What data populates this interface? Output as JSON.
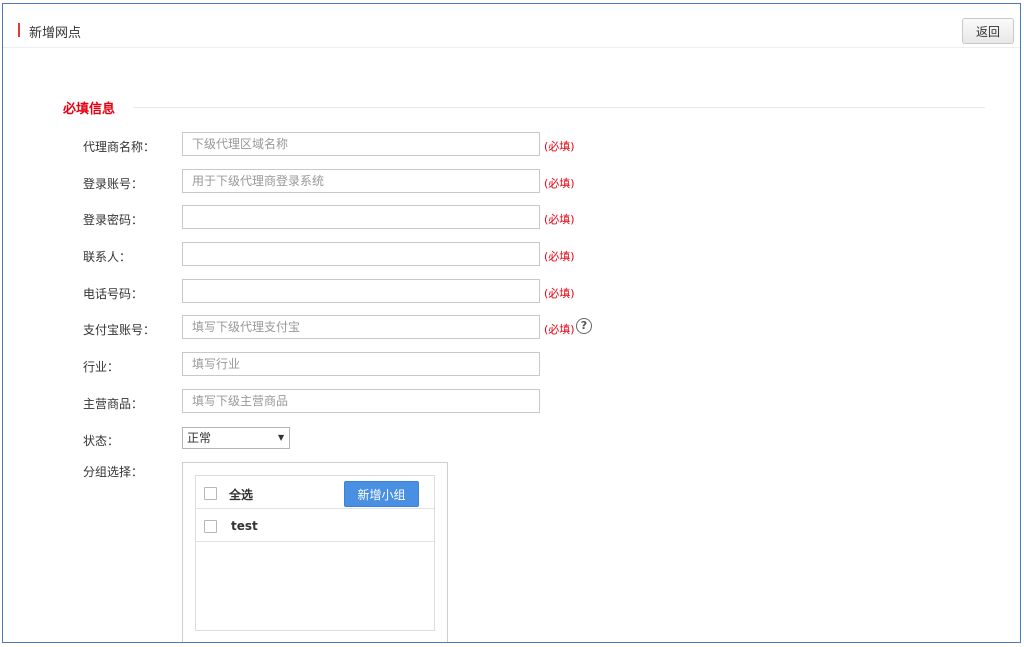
{
  "header": {
    "title": "新增网点",
    "back_label": "返回"
  },
  "section": {
    "title": "必填信息"
  },
  "required_text": "(必填)",
  "fields": [
    {
      "label": "代理商名称：",
      "placeholder": "下级代理区域名称",
      "required": true
    },
    {
      "label": "登录账号：",
      "placeholder": "用于下级代理商登录系统",
      "required": true
    },
    {
      "label": "登录密码：",
      "placeholder": "",
      "required": true
    },
    {
      "label": "联系人：",
      "placeholder": "",
      "required": true
    },
    {
      "label": "电话号码：",
      "placeholder": "",
      "required": true
    },
    {
      "label": "支付宝账号：",
      "placeholder": "填写下级代理支付宝",
      "required": true,
      "help_icon": "?"
    },
    {
      "label": "行业：",
      "placeholder": "填写行业",
      "required": false
    },
    {
      "label": "主营商品：",
      "placeholder": "填写下级主营商品",
      "required": false
    }
  ],
  "status": {
    "label": "状态：",
    "selected": "正常"
  },
  "group": {
    "label": "分组选择：",
    "select_all": "全选",
    "add_button": "新增小组",
    "items": [
      "test"
    ]
  },
  "colors": {
    "accent_red": "#e60012",
    "button_blue": "#4a90e2",
    "frame_border": "#4a7ab8"
  }
}
